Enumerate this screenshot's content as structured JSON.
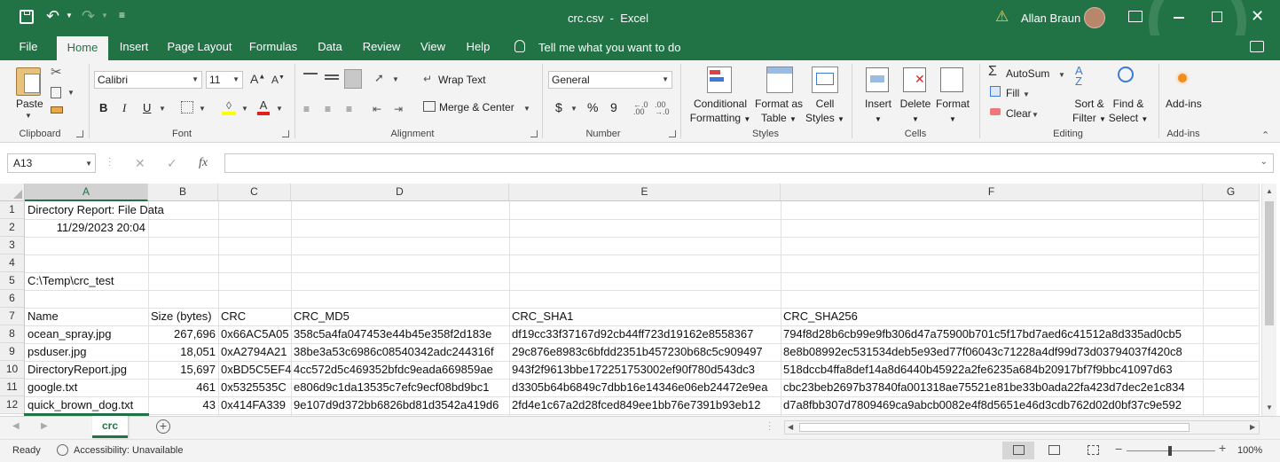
{
  "window": {
    "title": "crc.csv  -  Excel",
    "user": "Allan Braun"
  },
  "tabs": [
    "File",
    "Home",
    "Insert",
    "Page Layout",
    "Formulas",
    "Data",
    "Review",
    "View",
    "Help"
  ],
  "tell_me": "Tell me what you want to do",
  "ribbon": {
    "clipboard": {
      "paste": "Paste",
      "label": "Clipboard"
    },
    "font": {
      "name": "Calibri",
      "size": "11",
      "label": "Font",
      "bold": "B",
      "italic": "I",
      "underline": "U"
    },
    "alignment": {
      "wrap": "Wrap Text",
      "merge": "Merge & Center",
      "label": "Alignment"
    },
    "number": {
      "format": "General",
      "currency": "$",
      "percent": "%",
      "comma": "9",
      "label": "Number"
    },
    "styles": {
      "conditional_1": "Conditional",
      "conditional_2": "Formatting",
      "format_table_1": "Format as",
      "format_table_2": "Table",
      "cell_styles_1": "Cell",
      "cell_styles_2": "Styles",
      "label": "Styles"
    },
    "cells": {
      "insert": "Insert",
      "delete": "Delete",
      "format": "Format",
      "label": "Cells"
    },
    "editing": {
      "autosum": "AutoSum",
      "fill": "Fill",
      "clear": "Clear",
      "sort_1": "Sort &",
      "sort_2": "Filter",
      "find_1": "Find &",
      "find_2": "Select",
      "label": "Editing"
    },
    "addins": {
      "button": "Add-ins",
      "label": "Add-ins"
    }
  },
  "formula_bar": {
    "name_box": "A13",
    "fx": "fx",
    "value": ""
  },
  "columns": [
    "A",
    "B",
    "C",
    "D",
    "E",
    "F",
    "G"
  ],
  "rows": [
    "1",
    "2",
    "3",
    "4",
    "5",
    "6",
    "7",
    "8",
    "9",
    "10",
    "11",
    "12"
  ],
  "cells": {
    "r1": {
      "a": "Directory Report: File Data"
    },
    "r2": {
      "a": "11/29/2023 20:04"
    },
    "r5": {
      "a": "C:\\Temp\\crc_test"
    },
    "r7": {
      "a": "Name",
      "b": "Size (bytes)",
      "c": "CRC",
      "d": "CRC_MD5",
      "e": "CRC_SHA1",
      "f": "CRC_SHA256"
    },
    "r8": {
      "a": "ocean_spray.jpg",
      "b": "267,696",
      "c": "0x66AC5A05",
      "d": "358c5a4fa047453e44b45e358f2d183e",
      "e": "df19cc33f37167d92cb44ff723d19162e8558367",
      "f": "794f8d28b6cb99e9fb306d47a75900b701c5f17bd7aed6c41512a8d335ad0cb5"
    },
    "r9": {
      "a": "psduser.jpg",
      "b": "18,051",
      "c": "0xA2794A21",
      "d": "38be3a53c6986c08540342adc244316f",
      "e": "29c876e8983c6bfdd2351b457230b68c5c909497",
      "f": "8e8b08992ec531534deb5e93ed77f06043c71228a4df99d73d03794037f420c8"
    },
    "r10": {
      "a": "DirectoryReport.jpg",
      "b": "15,697",
      "c": "0xBD5C5EF4",
      "d": "4cc572d5c469352bfdc9eada669859ae",
      "e": "943f2f9613bbe172251753002ef90f780d543dc3",
      "f": "518dccb4ffa8def14a8d6440b45922a2fe6235a684b20917bf7f9bbc41097d63"
    },
    "r11": {
      "a": "google.txt",
      "b": "461",
      "c": "0x5325535C",
      "d": "e806d9c1da13535c7efc9ecf08bd9bc1",
      "e": "d3305b64b6849c7dbb16e14346e06eb24472e9ea",
      "f": "cbc23beb2697b37840fa001318ae75521e81be33b0ada22fa423d7dec2e1c834"
    },
    "r12": {
      "a": "quick_brown_dog.txt",
      "b": "43",
      "c": "0x414FA339",
      "d": "9e107d9d372bb6826bd81d3542a419d6",
      "e": "2fd4e1c67a2d28fced849ee1bb76e7391b93eb12",
      "f": "d7a8fbb307d7809469ca9abcb0082e4f8d5651e46d3cdb762d02d0bf37c9e592"
    }
  },
  "sheet_tab": "crc",
  "status": {
    "ready": "Ready",
    "accessibility": "Accessibility: Unavailable",
    "zoom": "100%"
  },
  "colors": {
    "accent": "#217346",
    "ribbon_bg": "#f3f3f3"
  }
}
